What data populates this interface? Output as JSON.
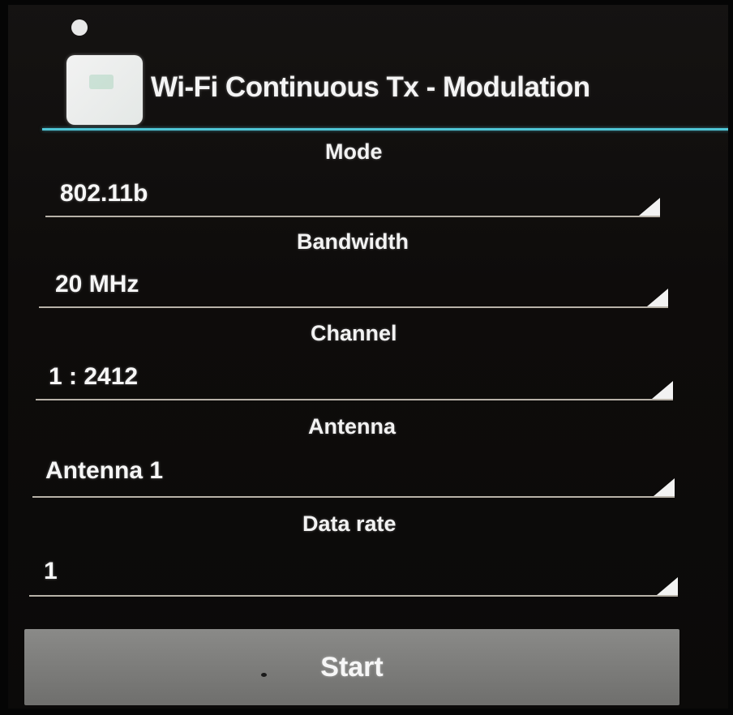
{
  "app": {
    "title": "Wi-Fi Continuous Tx - Modulation"
  },
  "fields": {
    "mode": {
      "label": "Mode",
      "value": "802.11b"
    },
    "bandwidth": {
      "label": "Bandwidth",
      "value": "20 MHz"
    },
    "channel": {
      "label": "Channel",
      "value": "1 : 2412"
    },
    "antenna": {
      "label": "Antenna",
      "value": "Antenna 1"
    },
    "data_rate": {
      "label": "Data rate",
      "value": "1"
    }
  },
  "actions": {
    "start_label": "Start"
  },
  "colors": {
    "accent": "#4fc4d4",
    "background": "#0e0c0b",
    "button": "#7c7c7a",
    "text": "#f4f4f4"
  }
}
